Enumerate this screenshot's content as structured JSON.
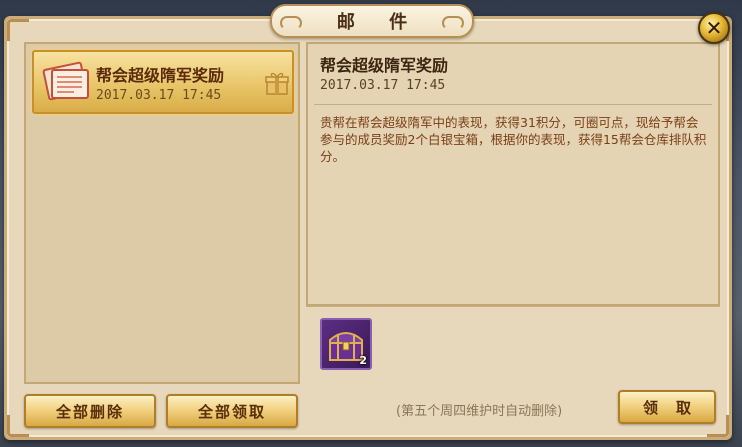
{
  "window": {
    "title": "邮  件"
  },
  "mail_list": [
    {
      "title": "帮会超级隋军奖励",
      "date": "2017.03.17  17:45"
    }
  ],
  "detail": {
    "title": "帮会超级隋军奖励",
    "date": "2017.03.17  17:45",
    "body": "贵帮在帮会超级隋军中的表现，获得31积分，可圈可点，现给予帮会参与的成员奖励2个白银宝箱，根据你的表现，获得15帮会仓库排队积分。",
    "reward": {
      "icon": "treasure-chest-icon",
      "count": "2"
    },
    "note": "(第五个周四维护时自动删除)"
  },
  "buttons": {
    "delete_all": "全部删除",
    "claim_all": "全部领取",
    "claim": "领取"
  },
  "colors": {
    "accent": "#e9c66a",
    "parchment": "#e7d8bb",
    "reward_frame": "#8a5fb0"
  }
}
